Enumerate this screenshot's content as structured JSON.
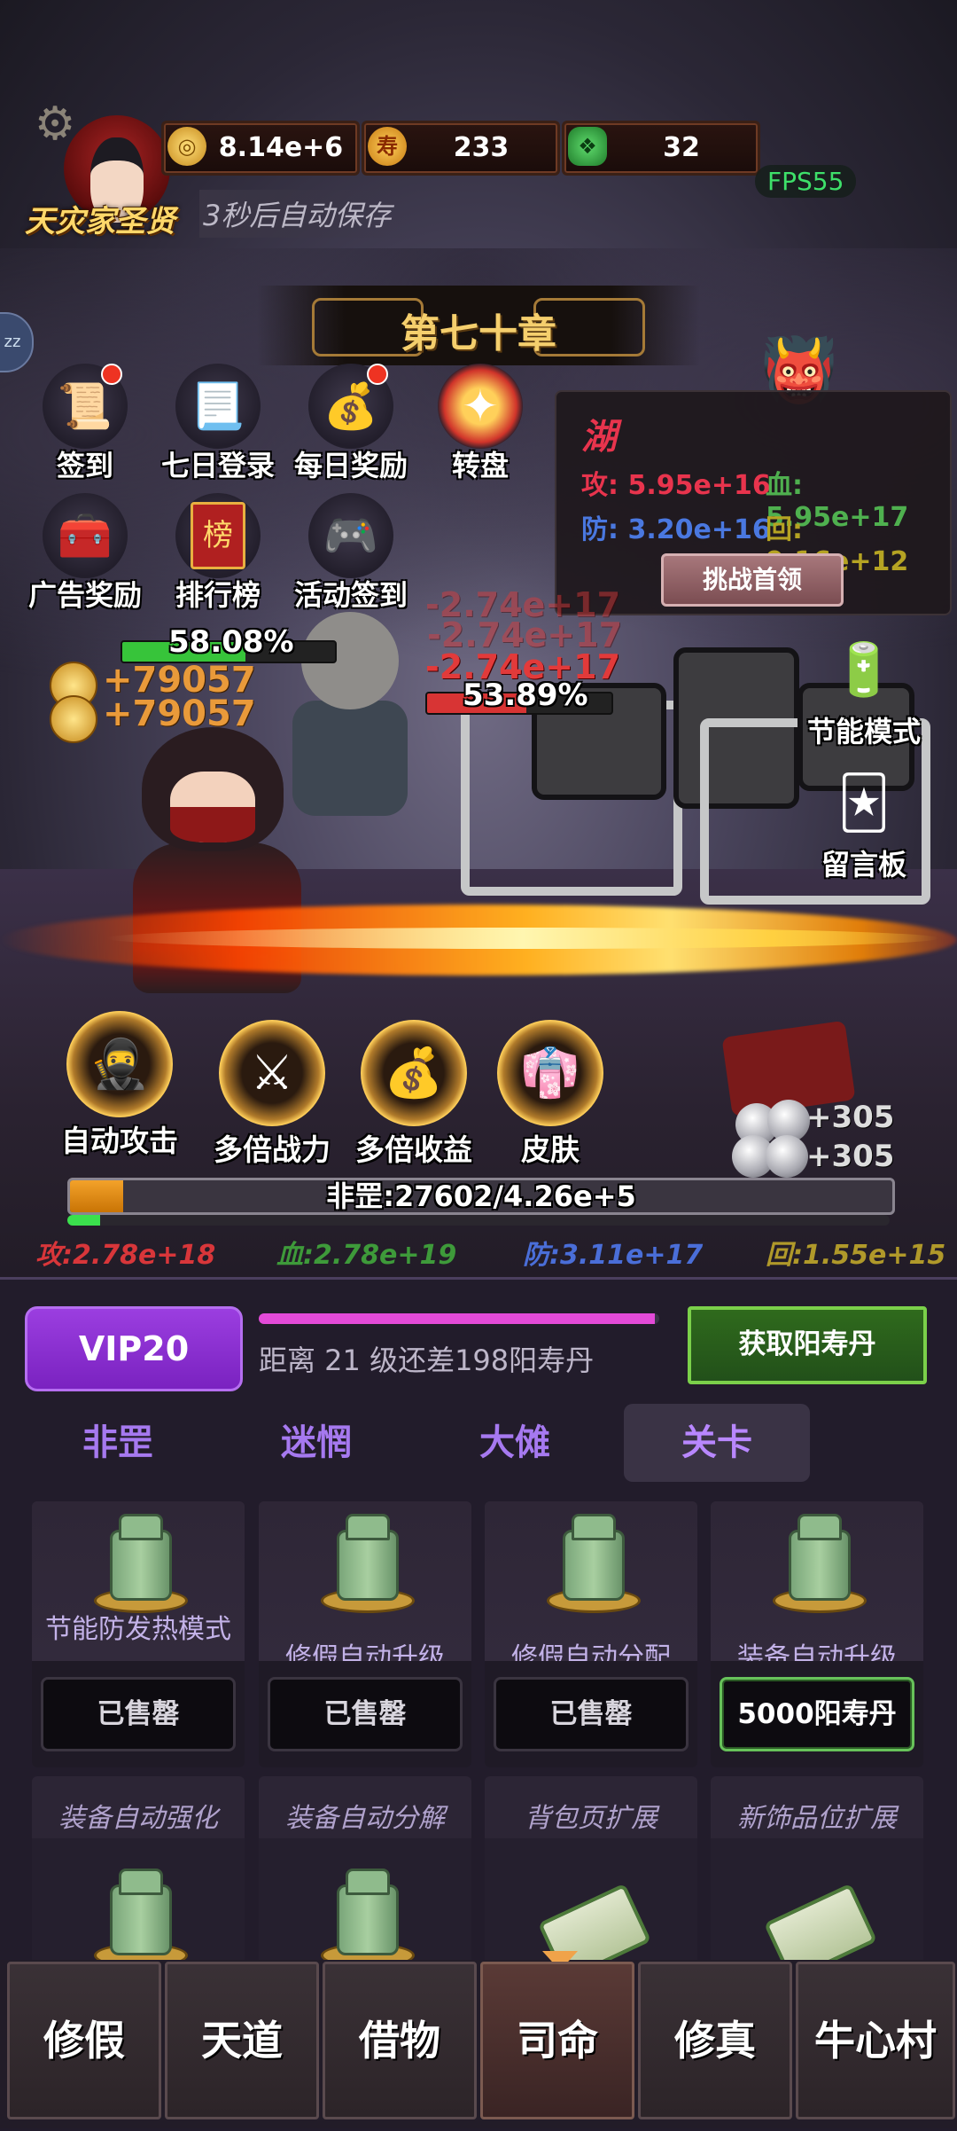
{
  "player": {
    "title": "天灾家圣贤",
    "autosave": "3秒后自动保存"
  },
  "resources": [
    {
      "icon": "coin-icon",
      "value": "8.14e+6"
    },
    {
      "icon": "longevity-icon",
      "glyph": "寿",
      "value": "233"
    },
    {
      "icon": "jade-icon",
      "value": "32"
    }
  ],
  "fps": "FPS55",
  "side_tab": "zz",
  "chapter": "第七十章",
  "features": [
    {
      "label": "签到",
      "icon": "sign-in-icon",
      "dot": true
    },
    {
      "label": "七日登录",
      "icon": "scroll-icon",
      "dot": false
    },
    {
      "label": "每日奖励",
      "icon": "bag-icon",
      "dot": true
    },
    {
      "label": "转盘",
      "icon": "wheel-icon",
      "dot": false
    },
    {
      "label": "广告奖励",
      "icon": "chest-icon",
      "dot": false
    },
    {
      "label": "排行榜",
      "icon": "ranking-icon",
      "glyph": "榜",
      "dot": false
    },
    {
      "label": "活动签到",
      "icon": "gamepad-icon",
      "dot": false
    }
  ],
  "boss": {
    "name": "湖",
    "atk_label": "攻: ",
    "atk": "5.95e+16",
    "hp_label": "血: ",
    "hp": "5.95e+17",
    "def_label": "防: ",
    "def": "3.20e+16",
    "regen_label": "回: ",
    "regen": "9.16e+12",
    "challenge": "挑战首领",
    "colors": {
      "atk": "#e8344d",
      "hp": "#4fb04f",
      "def": "#4a78e0",
      "regen": "#b5a323"
    }
  },
  "battle": {
    "player_hp_pct": "58.08%",
    "player_hp_fill": 0.5808,
    "enemy_hp_pct": "53.89%",
    "enemy_hp_fill": 0.5389,
    "gains": [
      "+79057",
      "+79057"
    ],
    "damage": [
      "-2.74e+17",
      "-2.74e+17",
      "-2.74e+17"
    ],
    "silver": [
      "+305",
      "+305"
    ]
  },
  "side_buttons": [
    {
      "label": "节能模式",
      "icon": "battery-icon"
    },
    {
      "label": "留言板",
      "icon": "cards-icon"
    }
  ],
  "skills": [
    {
      "label": "自动攻击",
      "icon": "auto-attack-icon"
    },
    {
      "label": "多倍战力",
      "icon": "power-multiplier-icon"
    },
    {
      "label": "多倍收益",
      "icon": "income-multiplier-icon"
    },
    {
      "label": "皮肤",
      "icon": "skin-icon"
    }
  ],
  "exp": {
    "text": "非罡:27602/4.26e+5",
    "fill": 0.0648,
    "sub_fill": 0.04
  },
  "stats": {
    "atk": "攻:2.78e+18",
    "hp": "血:2.78e+19",
    "def": "防:3.11e+17",
    "regen": "回:1.55e+15"
  },
  "vip": {
    "badge": "VIP20",
    "progress": 0.99,
    "desc": "距离 21 级还差198阳寿丹",
    "get_button": "获取阳寿丹"
  },
  "tabs": [
    "非罡",
    "迷惘",
    "大傩",
    "关卡"
  ],
  "active_tab": 3,
  "shop_row1": [
    {
      "title": "节能防发热模式",
      "button": "已售罄",
      "sold": true
    },
    {
      "title": "修假自动升级",
      "button": "已售罄",
      "sold": true
    },
    {
      "title": "修假自动分配",
      "button": "已售罄",
      "sold": true
    },
    {
      "title": "装备自动升级",
      "button": "5000阳寿丹",
      "sold": false
    }
  ],
  "shop_row2": [
    {
      "title": "装备自动强化",
      "icon": "jar-icon"
    },
    {
      "title": "装备自动分解",
      "icon": "jar-icon"
    },
    {
      "title": "背包页扩展",
      "icon": "scroll-icon"
    },
    {
      "title": "新饰品位扩展",
      "icon": "scroll-icon"
    }
  ],
  "nav": [
    "修假",
    "天道",
    "借物",
    "司命",
    "修真",
    "牛心村"
  ],
  "active_nav": 3
}
